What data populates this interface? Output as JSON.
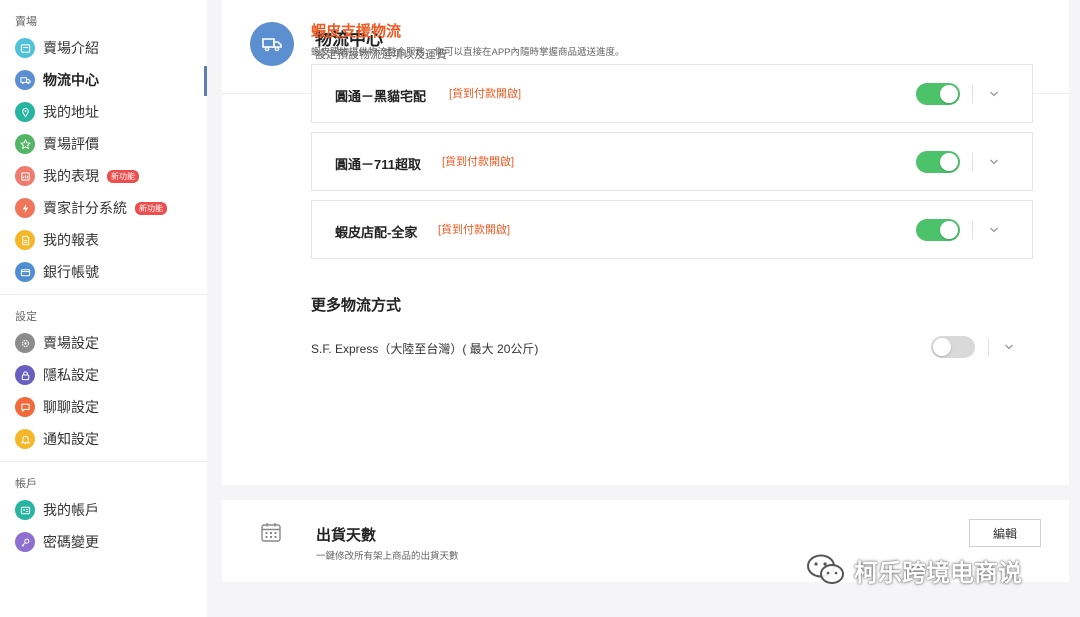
{
  "sidebar": {
    "sections": [
      {
        "header": "賣場",
        "items": [
          {
            "label": "賣場介紹",
            "icon": "store-intro-icon",
            "color": "#4fc1d8"
          },
          {
            "label": "物流中心",
            "icon": "truck-icon",
            "color": "#5b8fd0",
            "active": true
          },
          {
            "label": "我的地址",
            "icon": "location-pin-icon",
            "color": "#27b4a0"
          },
          {
            "label": "賣場評價",
            "icon": "star-icon",
            "color": "#53b565"
          },
          {
            "label": "我的表現",
            "icon": "performance-icon",
            "color": "#ef7b6e",
            "badge": "新功能"
          },
          {
            "label": "賣家計分系統",
            "icon": "lightning-icon",
            "color": "#f0765a",
            "badge": "新功能"
          },
          {
            "label": "我的報表",
            "icon": "report-icon",
            "color": "#f5b72a"
          },
          {
            "label": "銀行帳號",
            "icon": "bank-account-icon",
            "color": "#4f8fd1"
          }
        ]
      },
      {
        "header": "設定",
        "items": [
          {
            "label": "賣場設定",
            "icon": "gear-icon",
            "color": "#8c8c8c"
          },
          {
            "label": "隱私設定",
            "icon": "lock-icon",
            "color": "#6a5fc1"
          },
          {
            "label": "聊聊設定",
            "icon": "chat-icon",
            "color": "#f06a3b"
          },
          {
            "label": "通知設定",
            "icon": "bell-icon",
            "color": "#f5b72a"
          }
        ]
      },
      {
        "header": "帳戶",
        "items": [
          {
            "label": "我的帳戶",
            "icon": "id-card-icon",
            "color": "#27b4a0"
          },
          {
            "label": "密碼變更",
            "icon": "key-icon",
            "color": "#8e6fd0"
          }
        ]
      }
    ]
  },
  "header": {
    "title": "物流中心",
    "subtitle": "設定預設物流選項以及運費",
    "icon": "truck-icon"
  },
  "shopee_logistics": {
    "title": "蝦皮支援物流",
    "description": "蝦皮購物提供物流整合服務，你可以直接在APP內隨時掌握商品遞送進度。",
    "rows": [
      {
        "name": "圓通－黑貓宅配",
        "tag": "[貨到付款開啟]",
        "enabled": true
      },
      {
        "name": "圓通－711超取",
        "tag": "[貨到付款開啟]",
        "enabled": true
      },
      {
        "name": "蝦皮店配-全家",
        "tag": "[貨到付款開啟]",
        "enabled": true
      }
    ]
  },
  "more_logistics": {
    "title": "更多物流方式",
    "items": [
      {
        "label": "S.F. Express（大陸至台灣）( 最大 20公斤)",
        "enabled": false
      }
    ]
  },
  "shipping_days": {
    "title": "出貨天數",
    "description": "一鍵修改所有架上商品的出貨天數",
    "edit_label": "編輯"
  },
  "watermark": {
    "text": "柯乐跨境电商说"
  },
  "colors": {
    "accent_orange": "#ee5a24",
    "toggle_on": "#4cc36a",
    "toggle_off": "#d9d9d9",
    "header_icon": "#5b8fd0"
  }
}
